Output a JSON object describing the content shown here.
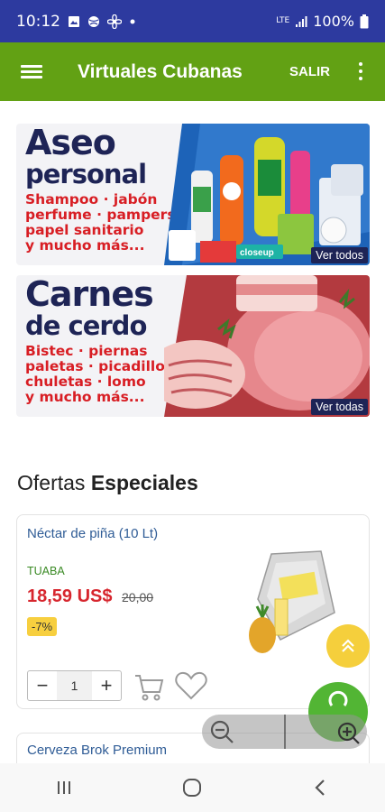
{
  "status": {
    "time": "10:12",
    "battery": "100%",
    "network": "LTE",
    "left_icons": [
      "image-icon",
      "ball-icon",
      "fan-icon",
      "dot-icon"
    ]
  },
  "appbar": {
    "title": "Virtuales Cubanas",
    "logout_label": "SALIR",
    "color": "#62a114"
  },
  "banners": [
    {
      "line1": "Aseo",
      "line2": "personal",
      "desc": [
        "Shampoo · jabón",
        "perfume · pampers",
        "papel sanitario",
        "y mucho más..."
      ],
      "link": "Ver todos",
      "product_label": "closeup"
    },
    {
      "line1": "Carnes",
      "line2": "de cerdo",
      "desc": [
        "Bistec · piernas",
        "paletas · picadillo",
        "chuletas · lomo",
        "y mucho más..."
      ],
      "link": "Ver todas"
    }
  ],
  "section": {
    "title_light": "Ofertas",
    "title_bold": "Especiales"
  },
  "product": {
    "name": "Néctar de piña (10 Lt)",
    "brand": "TUABA",
    "price": "18,59 US$",
    "old_price": "20,00",
    "discount": "-7%",
    "quantity": "1"
  },
  "product2": {
    "name": "Cerveza Brok Premium"
  },
  "colors": {
    "status_bar": "#2d3a9f",
    "accent": "#62a114",
    "price": "#d7262e",
    "discount_badge": "#f7cf3f",
    "banner_navy": "#1e2456"
  }
}
